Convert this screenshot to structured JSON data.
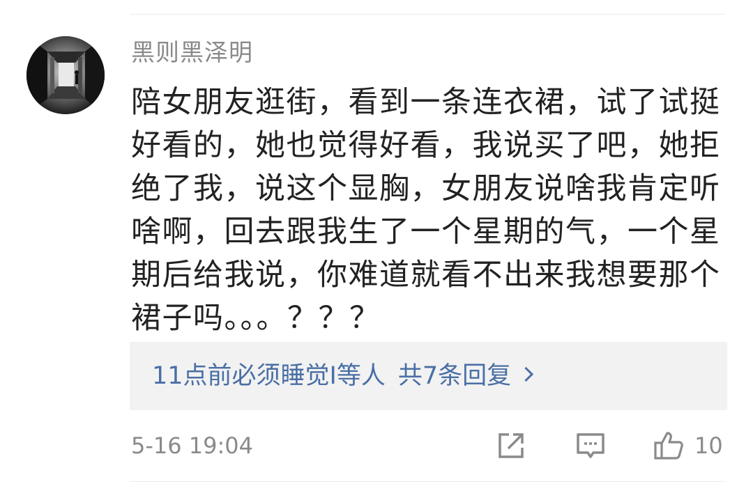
{
  "comment": {
    "username": "黑则黑泽明",
    "text": "陪女朋友逛街，看到一条连衣裙，试了试挺好看的，她也觉得好看，我说买了吧，她拒绝了我，说这个显胸，女朋友说啥我肯定听啥啊，回去跟我生了一个星期的气，一个星期后给我说，你难道就看不出来我想要那个裙子吗。。。？？？",
    "replies": {
      "users": "11点前必须睡觉I等人",
      "count_label": "共7条回复"
    },
    "timestamp": "5-16 19:04",
    "likes": "10"
  },
  "icons": {
    "share": "share-icon",
    "comment": "comment-icon",
    "like": "thumbs-up-icon",
    "chevron": "chevron-right-icon"
  },
  "colors": {
    "link": "#4a6fa5",
    "secondary_text": "#8a8a8a",
    "primary_text": "#222222",
    "reply_background": "#f2f2f2"
  }
}
